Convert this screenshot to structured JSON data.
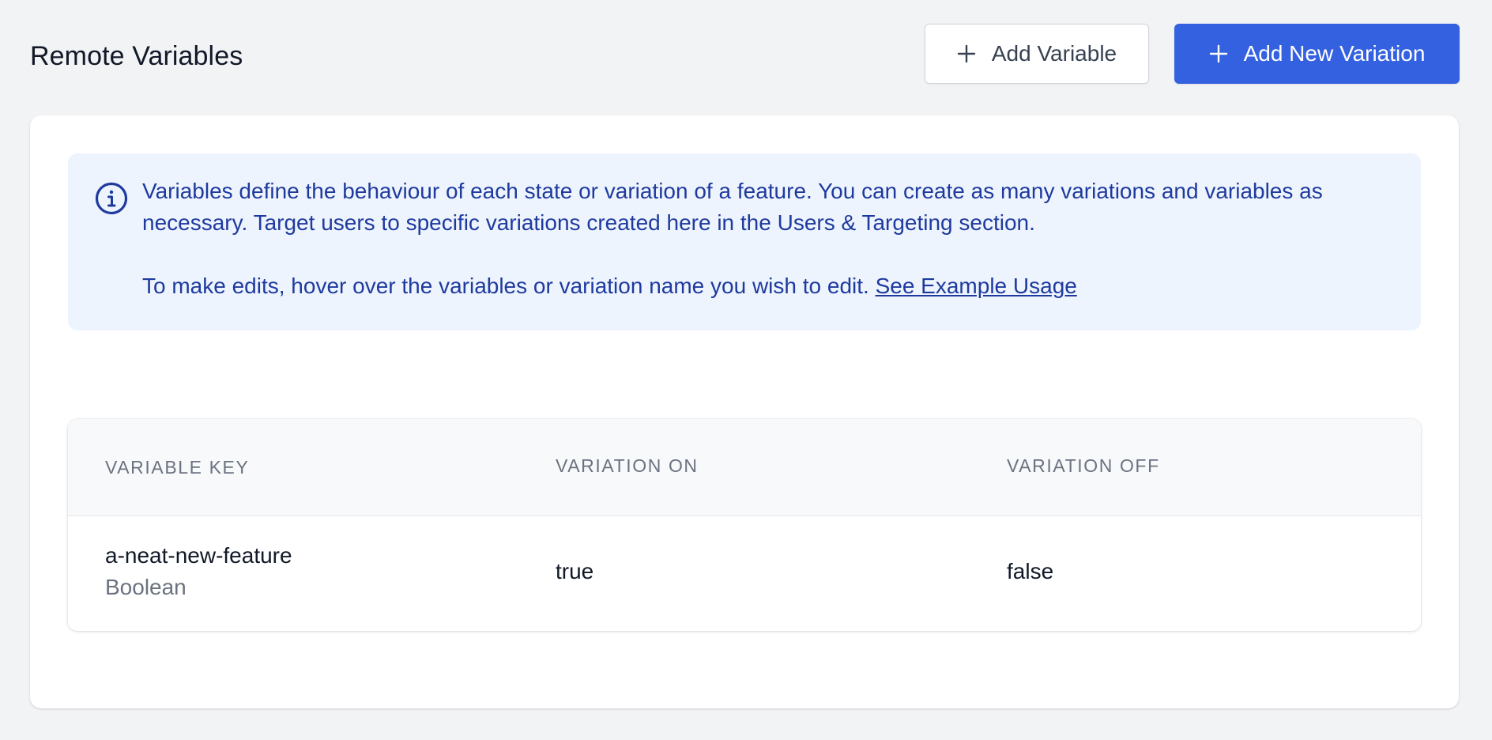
{
  "header": {
    "title": "Remote Variables",
    "add_variable_label": "Add Variable",
    "add_variation_label": "Add New Variation"
  },
  "info": {
    "icon": "info-circle-icon",
    "paragraph1": "Variables define the behaviour of each state or variation of a feature. You can create as many variations and variables as necessary. Target users to specific variations created here in the Users & Targeting section.",
    "paragraph2": "To make edits, hover over the variables or variation name you wish to edit.",
    "link_label": "See Example Usage"
  },
  "table": {
    "columns": [
      "Variable Key",
      "Variation On",
      "Variation Off"
    ],
    "rows": [
      {
        "key": "a-neat-new-feature",
        "type": "Boolean",
        "variation_on": "true",
        "variation_off": "false"
      }
    ]
  },
  "colors": {
    "primary": "#3461e0",
    "info_bg": "#eef4fd",
    "info_text": "#1e3a9e",
    "page_bg": "#f2f3f5"
  }
}
